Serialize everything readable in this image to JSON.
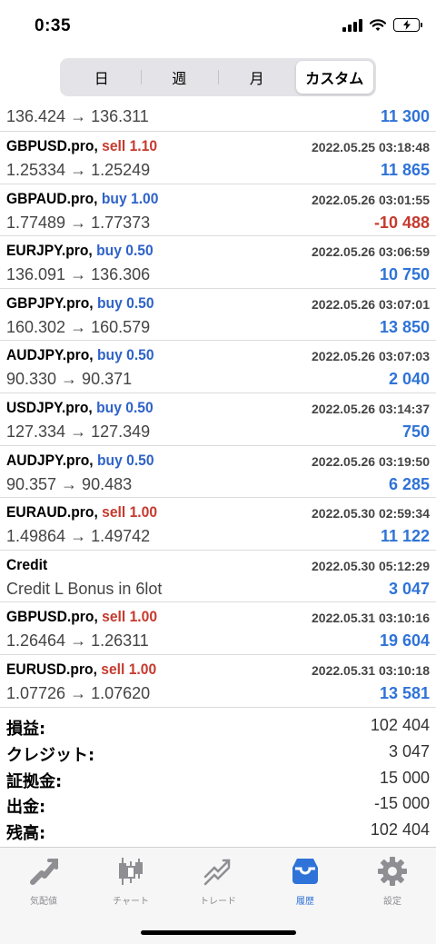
{
  "status": {
    "time": "0:35"
  },
  "tabs_top": [
    {
      "label": "日"
    },
    {
      "label": "週"
    },
    {
      "label": "月"
    },
    {
      "label": "カスタム"
    }
  ],
  "partial_row": {
    "price": "136.424 → 136.311",
    "profit": "11 300"
  },
  "trades": [
    {
      "symbol": "GBPUSD.pro,",
      "side": "sell 1.10",
      "date": "2022.05.25 03:18:48",
      "price": "1.25334 → 1.25249",
      "profit": "11 865"
    },
    {
      "symbol": "GBPAUD.pro,",
      "side": "buy 1.00",
      "date": "2022.05.26 03:01:55",
      "price": "1.77489 → 1.77373",
      "profit": "-10 488"
    },
    {
      "symbol": "EURJPY.pro,",
      "side": "buy 0.50",
      "date": "2022.05.26 03:06:59",
      "price": "136.091 → 136.306",
      "profit": "10 750"
    },
    {
      "symbol": "GBPJPY.pro,",
      "side": "buy 0.50",
      "date": "2022.05.26 03:07:01",
      "price": "160.302 → 160.579",
      "profit": "13 850"
    },
    {
      "symbol": "AUDJPY.pro,",
      "side": "buy 0.50",
      "date": "2022.05.26 03:07:03",
      "price": "90.330 → 90.371",
      "profit": "2 040"
    },
    {
      "symbol": "USDJPY.pro,",
      "side": "buy 0.50",
      "date": "2022.05.26 03:14:37",
      "price": "127.334 → 127.349",
      "profit": "750"
    },
    {
      "symbol": "AUDJPY.pro,",
      "side": "buy 0.50",
      "date": "2022.05.26 03:19:50",
      "price": "90.357 → 90.483",
      "profit": "6 285"
    },
    {
      "symbol": "EURAUD.pro,",
      "side": "sell 1.00",
      "date": "2022.05.30 02:59:34",
      "price": "1.49864 → 1.49742",
      "profit": "11 122"
    },
    {
      "symbol": "Credit",
      "side": "",
      "date": "2022.05.30 05:12:29",
      "price": "Credit L Bonus in 6lot",
      "profit": "3 047"
    },
    {
      "symbol": "GBPUSD.pro,",
      "side": "sell 1.00",
      "date": "2022.05.31 03:10:16",
      "price": "1.26464 → 1.26311",
      "profit": "19 604"
    },
    {
      "symbol": "EURUSD.pro,",
      "side": "sell 1.00",
      "date": "2022.05.31 03:10:18",
      "price": "1.07726 → 1.07620",
      "profit": "13 581"
    }
  ],
  "summary": [
    {
      "label": "損益:",
      "value": "102 404"
    },
    {
      "label": "クレジット:",
      "value": "3 047"
    },
    {
      "label": "証拠金:",
      "value": "15 000"
    },
    {
      "label": "出金:",
      "value": "-15 000"
    },
    {
      "label": "残高:",
      "value": "102 404"
    }
  ],
  "tabbar": [
    {
      "label": "気配値",
      "icon": "quotes-icon"
    },
    {
      "label": "チャート",
      "icon": "chart-icon"
    },
    {
      "label": "トレード",
      "icon": "trade-icon"
    },
    {
      "label": "履歴",
      "icon": "history-icon"
    },
    {
      "label": "設定",
      "icon": "settings-icon"
    }
  ],
  "colors": {
    "buy": "#2f63c8",
    "sell": "#c63a2e",
    "positive": "#2f73d8",
    "negative": "#c63a2e",
    "active_tab": "#2f73d8",
    "inactive_tab": "#8e8e93"
  }
}
